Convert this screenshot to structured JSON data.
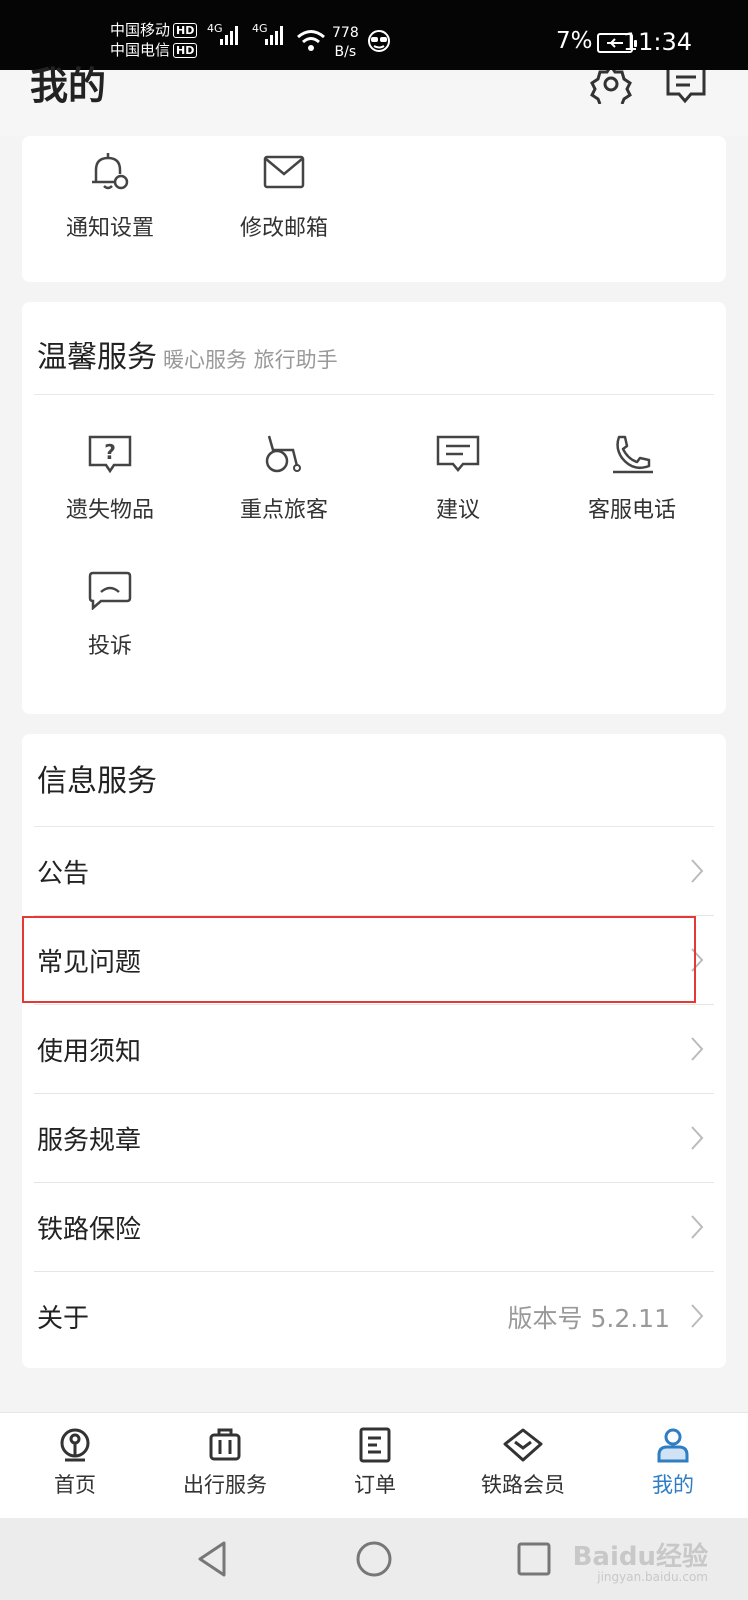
{
  "status_bar": {
    "carrier1": "中国移动",
    "carrier2": "中国电信",
    "hd": "HD",
    "net1": "4G",
    "net2": "4G",
    "speed_value": "778",
    "speed_unit": "B/s",
    "battery": "7%",
    "time": "11:34"
  },
  "header": {
    "title": "我的",
    "settings_icon": "gear-icon",
    "message_icon": "message-icon"
  },
  "account_card": {
    "items": [
      {
        "label": "通知设置",
        "icon": "bell-gear-icon"
      },
      {
        "label": "修改邮箱",
        "icon": "mail-icon"
      }
    ]
  },
  "warm_service": {
    "title": "温馨服务",
    "subtitle": "暖心服务 旅行助手",
    "items": [
      {
        "label": "遗失物品",
        "icon": "question-box-icon"
      },
      {
        "label": "重点旅客",
        "icon": "wheelchair-icon"
      },
      {
        "label": "建议",
        "icon": "comment-icon"
      },
      {
        "label": "客服电话",
        "icon": "phone-icon"
      },
      {
        "label": "投诉",
        "icon": "sad-chat-icon"
      }
    ]
  },
  "info_service": {
    "title": "信息服务",
    "rows": [
      {
        "label": "公告",
        "value": ""
      },
      {
        "label": "常见问题",
        "value": ""
      },
      {
        "label": "使用须知",
        "value": ""
      },
      {
        "label": "服务规章",
        "value": ""
      },
      {
        "label": "铁路保险",
        "value": ""
      },
      {
        "label": "关于",
        "value": "版本号 5.2.11"
      }
    ],
    "highlighted_row": "常见问题"
  },
  "tabbar": {
    "tabs": [
      {
        "label": "首页",
        "icon": "railway-logo-icon",
        "active": false
      },
      {
        "label": "出行服务",
        "icon": "luggage-icon",
        "active": false
      },
      {
        "label": "订单",
        "icon": "order-icon",
        "active": false
      },
      {
        "label": "铁路会员",
        "icon": "diamond-icon",
        "active": false
      },
      {
        "label": "我的",
        "icon": "person-icon",
        "active": true
      }
    ],
    "active_color": "#2f7ec4"
  },
  "watermark": {
    "text": "Baidu经验",
    "sub": "jingyan.baidu.com"
  }
}
